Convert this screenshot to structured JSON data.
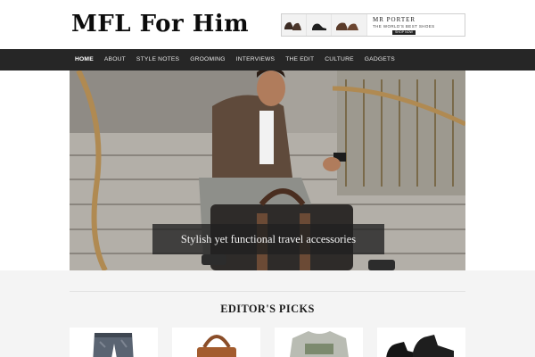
{
  "site": {
    "logo": "MFL For Him"
  },
  "banner_ad": {
    "brand": "MR PORTER",
    "tagline": "THE WORLD'S BEST SHOES",
    "cta": "SHOP NOW",
    "images": [
      "shoe-pair-icon",
      "shoe-single-icon",
      "shoe-pair-icon"
    ]
  },
  "nav": {
    "items": [
      {
        "label": "HOME",
        "active": true
      },
      {
        "label": "ABOUT",
        "active": false
      },
      {
        "label": "STYLE NOTES",
        "active": false
      },
      {
        "label": "GROOMING",
        "active": false
      },
      {
        "label": "INTERVIEWS",
        "active": false
      },
      {
        "label": "THE EDIT",
        "active": false
      },
      {
        "label": "CULTURE",
        "active": false
      },
      {
        "label": "GADGETS",
        "active": false
      }
    ]
  },
  "hero": {
    "caption": "Stylish yet functional travel accessories",
    "image": "man-on-stairs-with-travel-bag"
  },
  "editors_picks": {
    "heading": "EDITOR'S PICKS",
    "items": [
      {
        "image": "jeans"
      },
      {
        "image": "leather-bag"
      },
      {
        "image": "sweater"
      },
      {
        "image": "shoes"
      }
    ]
  },
  "colors": {
    "nav_background": "#262626",
    "caption_background": "#202020",
    "picks_background": "#f4f4f4"
  }
}
